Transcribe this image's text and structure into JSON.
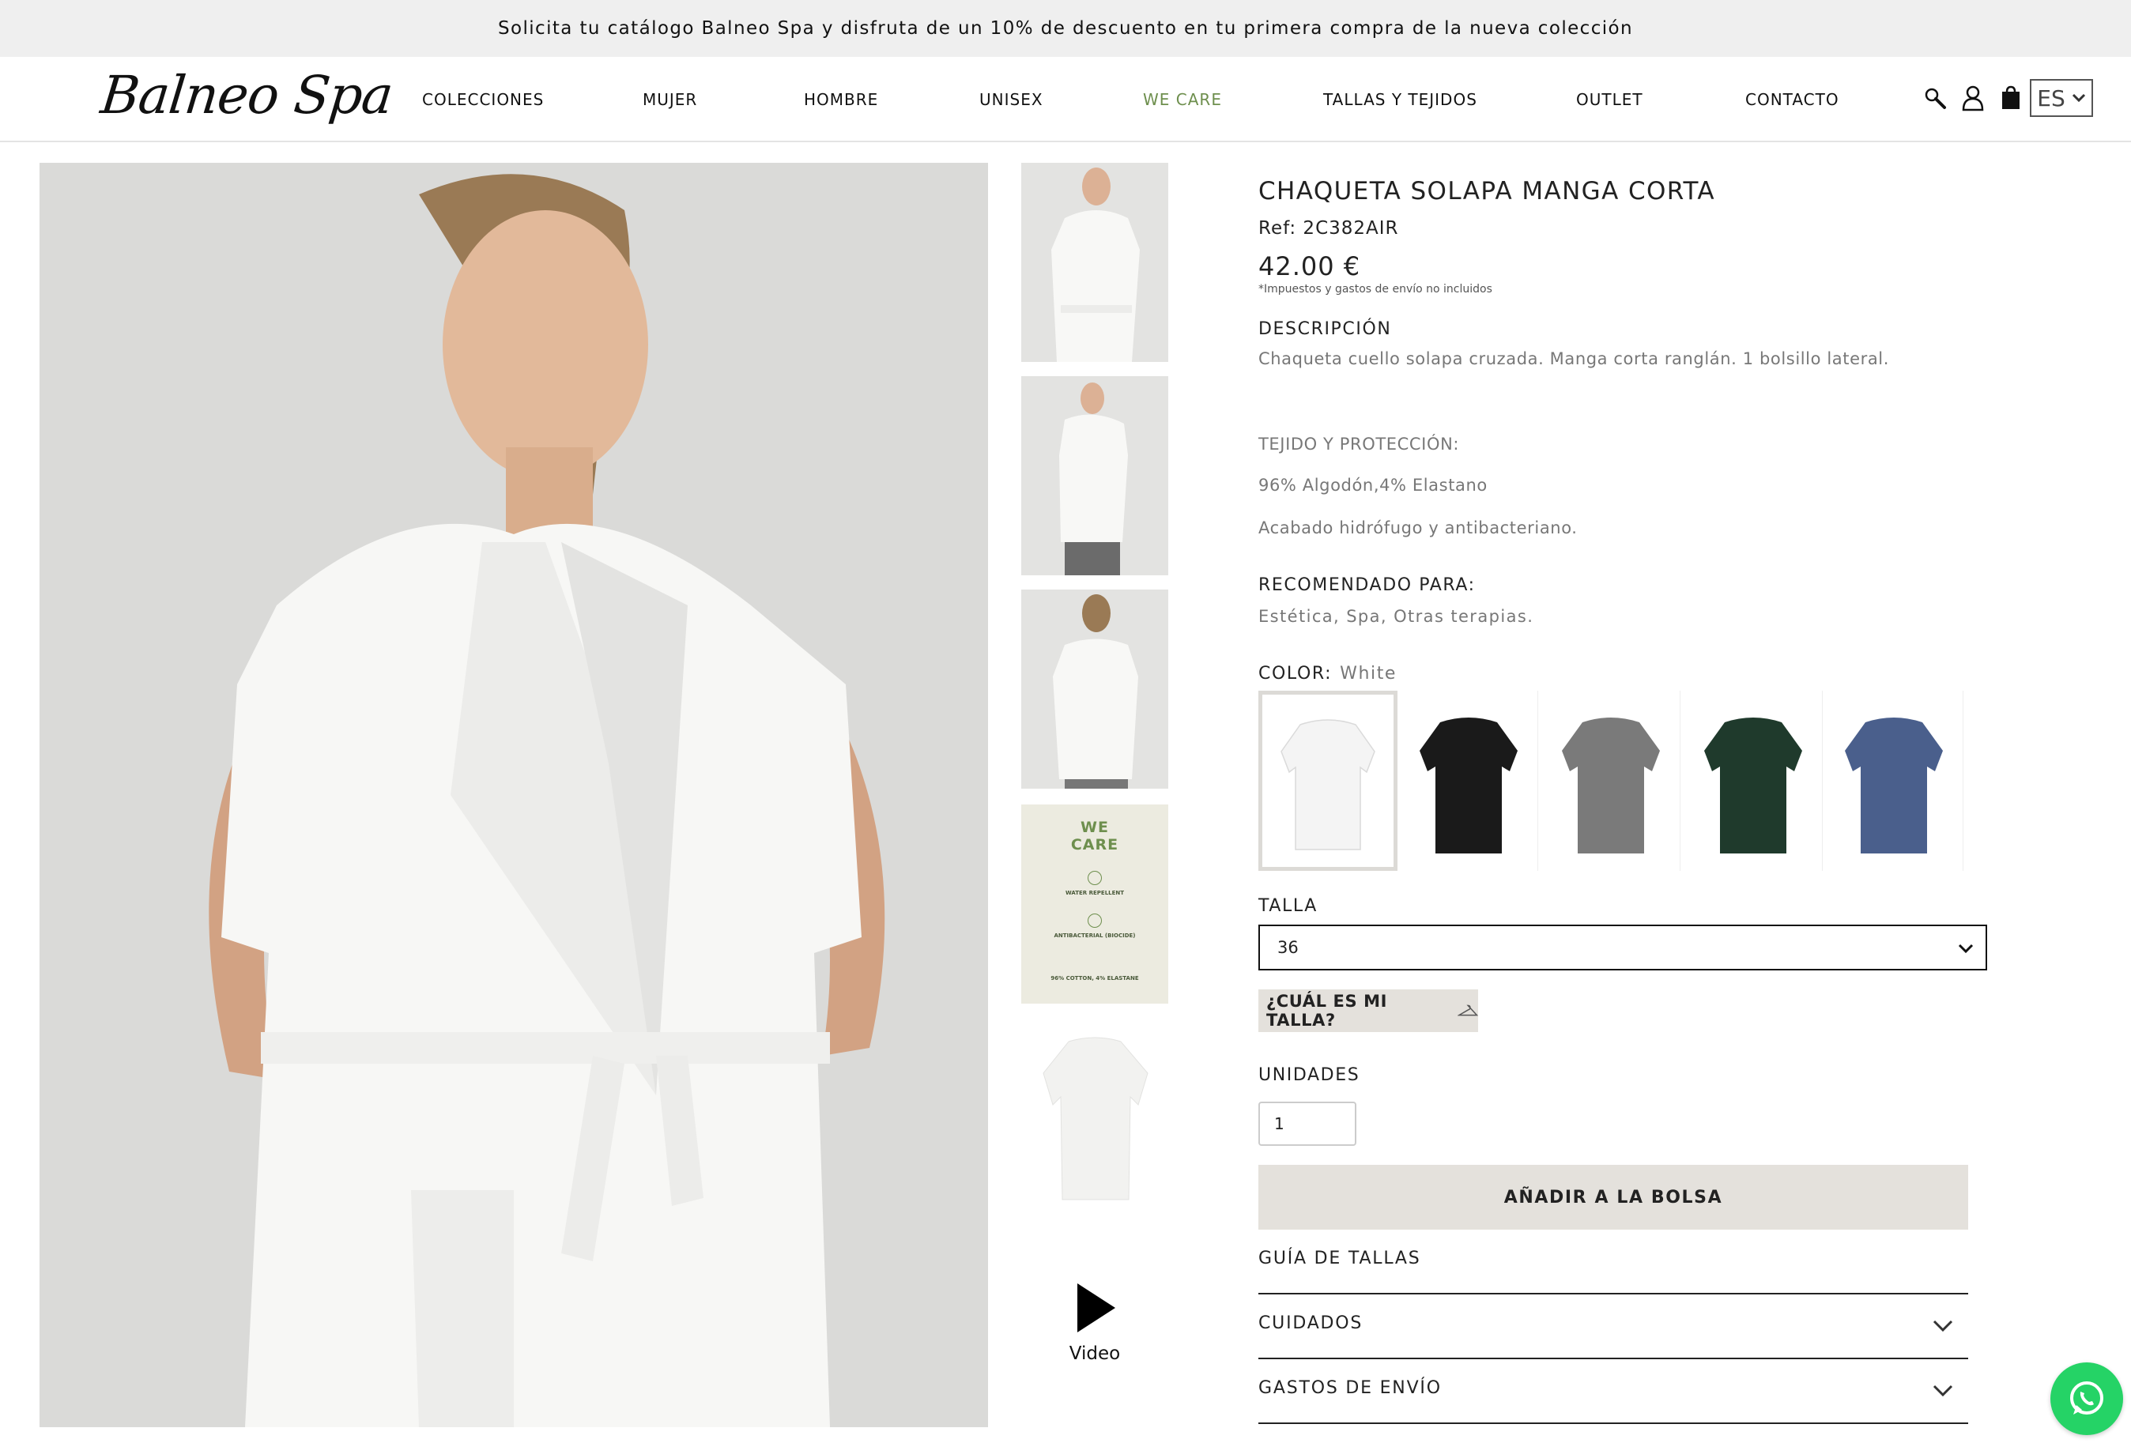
{
  "announcement": "Solicita tu catálogo Balneo Spa y disfruta de un 10% de descuento en tu primera compra de la nueva colección",
  "header": {
    "logo": "Balneo Spa",
    "nav": [
      "COLECCIONES",
      "MUJER",
      "HOMBRE",
      "UNISEX",
      "WE CARE",
      "TALLAS Y TEJIDOS",
      "OUTLET",
      "CONTACTO"
    ],
    "active_nav": "WE CARE",
    "language": "ES",
    "icons": [
      "search-icon",
      "user-icon",
      "bag-icon",
      "chevron-down-icon"
    ]
  },
  "gallery": {
    "wecare_thumb": {
      "title_line1": "WE",
      "title_line2": "CARE",
      "badge1": "WATER REPELLENT",
      "badge2": "ANTIBACTERIAL (BIOCIDE)",
      "composition": "96% COTTON, 4% ELASTANE"
    },
    "video_label": "Video"
  },
  "product": {
    "title": "CHAQUETA SOLAPA MANGA CORTA",
    "ref": "Ref: 2C382AIR",
    "price": "42.00 €",
    "tax_note": "*Impuestos y gastos de envío no incluidos",
    "description_heading": "DESCRIPCIÓN",
    "description": "Chaqueta cuello solapa cruzada. Manga corta ranglán. 1 bolsillo lateral.",
    "fabric_heading": "TEJIDO Y PROTECCIÓN:",
    "fabric_composition": "96% Algodón,4% Elastano",
    "fabric_finish": "Acabado hidrófugo y antibacteriano.",
    "recommended_heading": "RECOMENDADO PARA:",
    "recommended": "Estética, Spa, Otras terapias.",
    "color_label": "COLOR:",
    "color_value": "White",
    "colors": [
      {
        "name": "White",
        "hex": "#f4f4f4",
        "selected": true
      },
      {
        "name": "Black",
        "hex": "#1a1a1a",
        "selected": false
      },
      {
        "name": "Grey",
        "hex": "#7a7a7a",
        "selected": false
      },
      {
        "name": "Green",
        "hex": "#1f3a2c",
        "selected": false
      },
      {
        "name": "Blue",
        "hex": "#4a5f8c",
        "selected": false
      }
    ],
    "size_label": "TALLA",
    "size_value": "36",
    "size_help": "¿CUÁL ES MI TALLA?",
    "units_label": "UNIDADES",
    "units_value": "1",
    "add_button": "AÑADIR A LA BOLSA",
    "accordion": [
      "GUÍA DE TALLAS",
      "CUIDADOS",
      "GASTOS DE ENVÍO"
    ]
  },
  "colors": {
    "accent_green": "#6e8f4e",
    "button_bg": "#e4e1dc",
    "whatsapp": "#25d366"
  }
}
